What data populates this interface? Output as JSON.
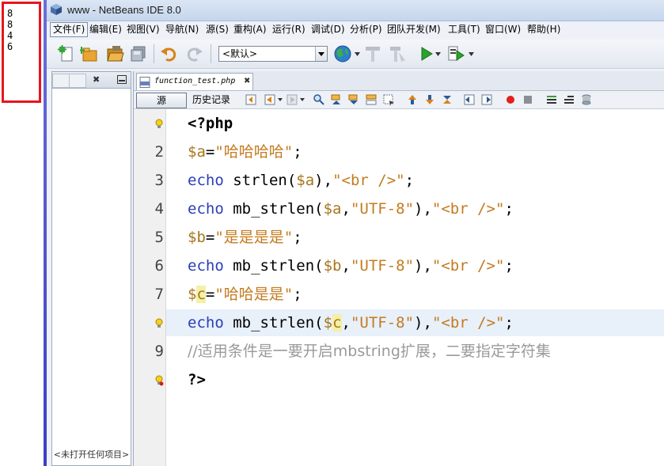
{
  "output": {
    "lines": [
      "8",
      "8",
      "4",
      "6"
    ]
  },
  "window": {
    "title": "www - NetBeans IDE 8.0"
  },
  "menu": [
    "文件(F)",
    "编辑(E)",
    "视图(V)",
    "导航(N)",
    "源(S)",
    "重构(A)",
    "运行(R)",
    "调试(D)",
    "分析(P)",
    "团队开发(M)",
    "工具(T)",
    "窗口(W)",
    "帮助(H)"
  ],
  "toolbar": {
    "config_value": "<默认>"
  },
  "projects": {
    "empty_text": "<未打开任何项目>"
  },
  "editor": {
    "tab_name": "function_test.php",
    "source_label": "源",
    "history_label": "历史记录",
    "line_numbers": [
      "",
      "2",
      "3",
      "4",
      "5",
      "6",
      "7",
      "",
      "9",
      ""
    ],
    "code": {
      "l1": "<?php",
      "l2_var": "$a",
      "l2_eq": "=",
      "l2_str": "\"哈哈哈哈\"",
      "l2_end": ";",
      "l3_kw": "echo",
      "l3_fn": " strlen(",
      "l3_var": "$a",
      "l3_mid": "),",
      "l3_str": "\"<br />\"",
      "l3_end": ";",
      "l4_kw": "echo",
      "l4_fn": " mb_strlen(",
      "l4_var": "$a",
      "l4_c": ",",
      "l4_enc": "\"UTF-8\"",
      "l4_mid": "),",
      "l4_str": "\"<br />\"",
      "l4_end": ";",
      "l5_var": "$b",
      "l5_eq": "=",
      "l5_str": "\"是是是是\"",
      "l5_end": ";",
      "l6_kw": "echo",
      "l6_fn": " mb_strlen(",
      "l6_var": "$b",
      "l6_c": ",",
      "l6_enc": "\"UTF-8\"",
      "l6_mid": "),",
      "l6_str": "\"<br />\"",
      "l6_end": ";",
      "l7_var1": "$",
      "l7_var2": "c",
      "l7_eq": "=",
      "l7_str": "\"哈哈是是\"",
      "l7_end": ";",
      "l8_kw": "echo",
      "l8_fn": " mb_strlen(",
      "l8_var1": "$",
      "l8_var2": "c",
      "l8_c": ",",
      "l8_enc": "\"UTF-8\"",
      "l8_mid": "),",
      "l8_str": "\"<br />\"",
      "l8_end": ";",
      "l9": "//适用条件是一要开启mbstring扩展，二要指定字符集",
      "l10": "?>"
    }
  },
  "colors": {
    "keyword": "#2a3fb8",
    "variable": "#a8771e",
    "string": "#c47b1f",
    "comment": "#9a9a9a",
    "highlight_border": "#e8141c"
  }
}
